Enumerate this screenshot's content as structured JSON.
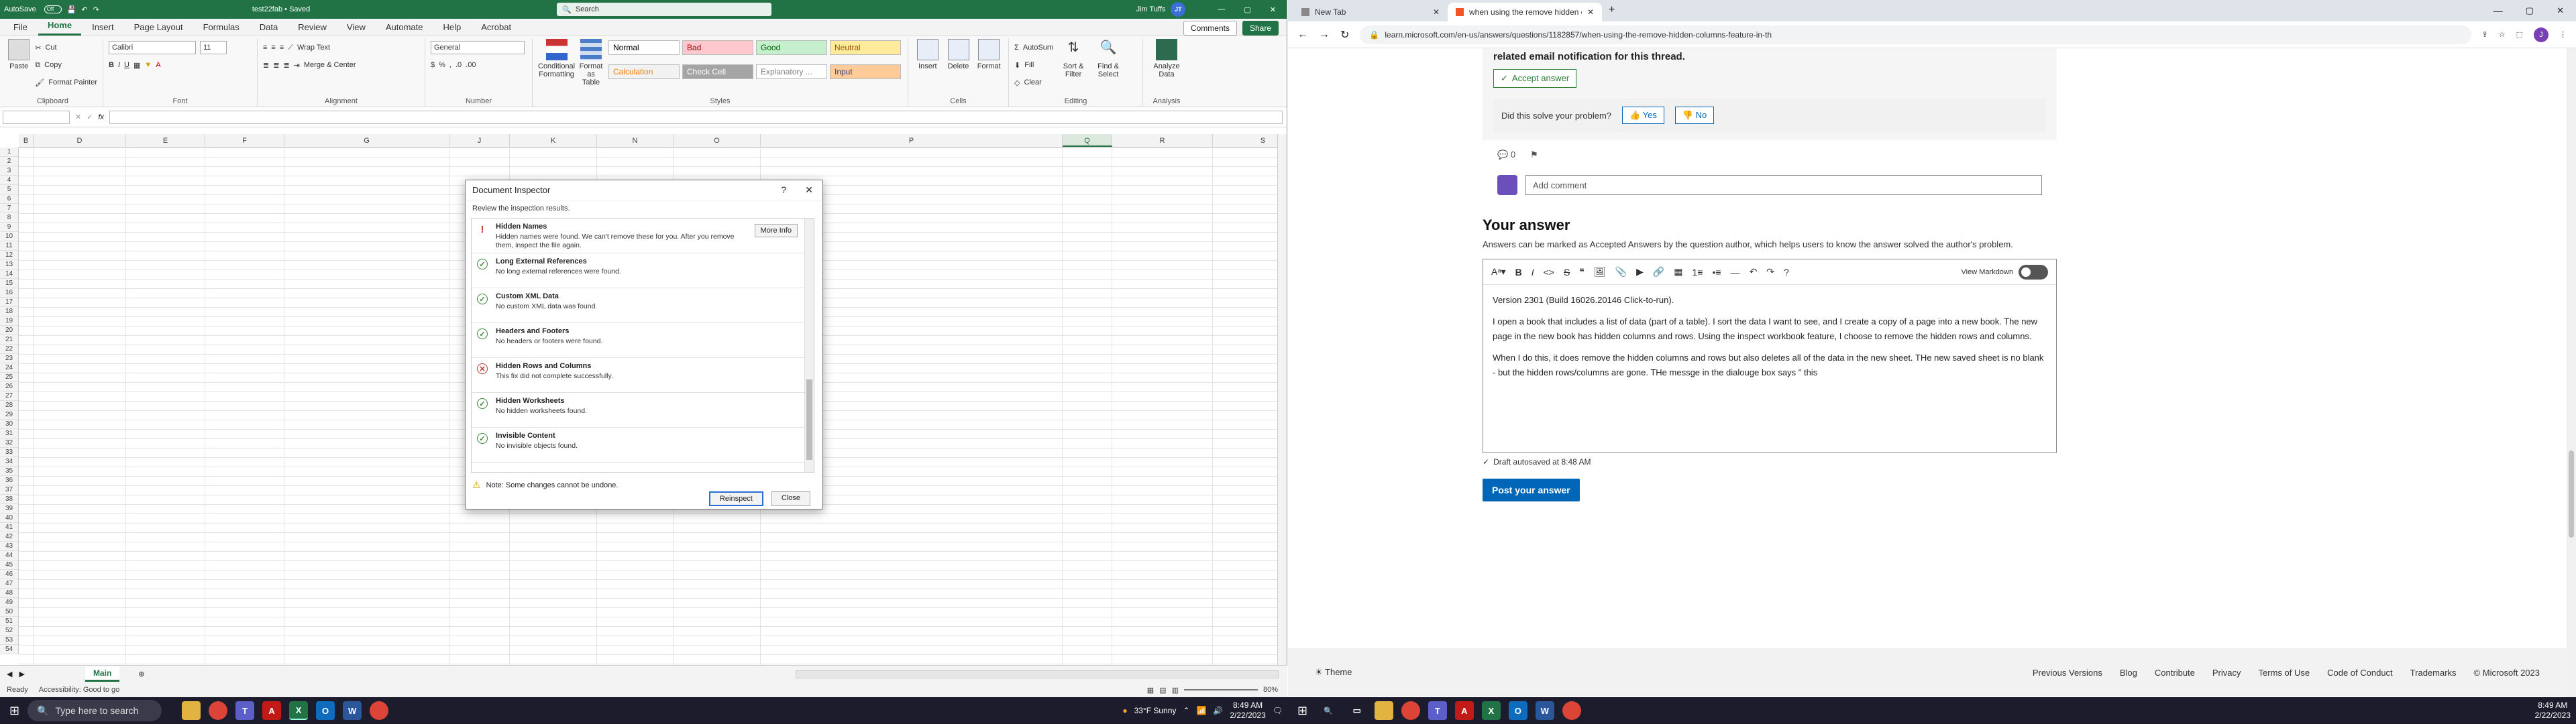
{
  "excel": {
    "title": {
      "autosave_label": "AutoSave",
      "autosave_state": "Off",
      "filename": "test22fab • Saved",
      "search_placeholder": "Search",
      "user_name": "Jim Tuffs",
      "user_initials": "JT"
    },
    "tabs": [
      "File",
      "Home",
      "Insert",
      "Page Layout",
      "Formulas",
      "Data",
      "Review",
      "View",
      "Automate",
      "Help",
      "Acrobat"
    ],
    "comments_btn": "Comments",
    "share_btn": "Share",
    "ribbon": {
      "clipboard": {
        "paste": "Paste",
        "cut": "Cut",
        "copy": "Copy",
        "format_painter": "Format Painter",
        "label": "Clipboard"
      },
      "font": {
        "name": "Calibri",
        "size": "11",
        "label": "Font"
      },
      "alignment": {
        "wrap": "Wrap Text",
        "merge": "Merge & Center",
        "label": "Alignment"
      },
      "number": {
        "format": "General",
        "label": "Number"
      },
      "styles": {
        "cond_format": "Conditional Formatting",
        "format_table": "Format as Table",
        "cells": [
          {
            "name": "Normal",
            "bg": "#ffffff",
            "fg": "#000000"
          },
          {
            "name": "Bad",
            "bg": "#ffc7ce",
            "fg": "#9c0006"
          },
          {
            "name": "Good",
            "bg": "#c6efce",
            "fg": "#006100"
          },
          {
            "name": "Neutral",
            "bg": "#ffeb9c",
            "fg": "#9c5700"
          },
          {
            "name": "Calculation",
            "bg": "#f2f2f2",
            "fg": "#fa7d00"
          },
          {
            "name": "Check Cell",
            "bg": "#a5a5a5",
            "fg": "#ffffff"
          },
          {
            "name": "Explanatory ...",
            "bg": "#ffffff",
            "fg": "#7f7f7f"
          },
          {
            "name": "Input",
            "bg": "#ffcc99",
            "fg": "#3f3f76"
          }
        ],
        "label": "Styles"
      },
      "cells": {
        "insert": "Insert",
        "delete": "Delete",
        "format": "Format",
        "label": "Cells"
      },
      "editing": {
        "autosum": "AutoSum",
        "fill": "Fill",
        "clear": "Clear",
        "sort": "Sort & Filter",
        "find": "Find & Select",
        "label": "Editing"
      },
      "analysis": {
        "analyze": "Analyze Data",
        "label": "Analysis"
      }
    },
    "formula_bar": {
      "fx": "fx"
    },
    "columns": [
      "B",
      "D",
      "E",
      "F",
      "G",
      "J",
      "K",
      "N",
      "O",
      "P",
      "Q",
      "R",
      "S"
    ],
    "selected_column": "Q",
    "rows": [
      "1",
      "2",
      "3",
      "4",
      "5",
      "6",
      "7",
      "8",
      "9",
      "10",
      "11",
      "12",
      "13",
      "14",
      "15",
      "16",
      "17",
      "18",
      "19",
      "20",
      "21",
      "22",
      "23",
      "24",
      "25",
      "26",
      "27",
      "28",
      "29",
      "30",
      "31",
      "32",
      "33",
      "34",
      "35",
      "36",
      "37",
      "38",
      "39",
      "40",
      "41",
      "42",
      "43",
      "44",
      "45",
      "46",
      "47",
      "48",
      "49",
      "50",
      "51",
      "52",
      "53",
      "54"
    ],
    "sheet_tab": "Main",
    "status": {
      "ready": "Ready",
      "accessibility": "Accessibility: Good to go",
      "zoom": "80%"
    }
  },
  "dialog": {
    "title": "Document Inspector",
    "subtitle": "Review the inspection results.",
    "items": [
      {
        "title": "Hidden Names",
        "desc": "Hidden names were found. We can't remove these for you. After you remove them, inspect the file again.",
        "status": "warn",
        "button": "More Info"
      },
      {
        "title": "Long External References",
        "desc": "No long external references were found.",
        "status": "ok"
      },
      {
        "title": "Custom XML Data",
        "desc": "No custom XML data was found.",
        "status": "ok"
      },
      {
        "title": "Headers and Footers",
        "desc": "No headers or footers were found.",
        "status": "ok"
      },
      {
        "title": "Hidden Rows and Columns",
        "desc": "This fix did not complete successfully.",
        "status": "err"
      },
      {
        "title": "Hidden Worksheets",
        "desc": "No hidden worksheets found.",
        "status": "ok"
      },
      {
        "title": "Invisible Content",
        "desc": "No invisible objects found.",
        "status": "ok"
      }
    ],
    "note": "Note: Some changes cannot be undone.",
    "reinspect": "Reinspect",
    "close": "Close",
    "help": "?",
    "x": "✕"
  },
  "browser": {
    "tabs": [
      {
        "label": "New Tab",
        "active": false
      },
      {
        "label": "when using the remove hidden c...",
        "active": true
      }
    ],
    "url": "learn.microsoft.com/en-us/answers/questions/1182857/when-using-the-remove-hidden-columns-feature-in-th",
    "profile": "J",
    "notify_text": "related email notification for this thread.",
    "accept_btn": "Accept answer",
    "solve_q": "Did this solve your problem?",
    "yes": "Yes",
    "no": "No",
    "comment_count": "0",
    "comment_placeholder": "Add comment",
    "your_answer": "Your answer",
    "answer_note": "Answers can be marked as Accepted Answers by the question author, which helps users to know the answer solved the author's problem.",
    "view_markdown": "View Markdown",
    "editor_paragraphs": [
      "Version 2301 (Build 16026.20146 Click-to-run).",
      "I open a book that includes a list of data (part of a table).  I sort the data I want to see, and I create a copy of a page into a new book.    The new page in the new book has hidden columns and rows.  Using the inspect workbook feature, I choose to remove the hidden rows and columns.",
      "When I do this, it does remove the hidden columns and rows but also deletes all of the data in the new sheet.  THe new saved sheet is no blank - but the hidden rows/columns are gone.  THe messge in the dialouge box says \" this"
    ],
    "draft_saved": "Draft autosaved at 8:48 AM",
    "post_btn": "Post your answer",
    "footer": {
      "theme": "Theme",
      "links": [
        "Previous Versions",
        "Blog",
        "Contribute",
        "Privacy",
        "Terms of Use",
        "Code of Conduct",
        "Trademarks",
        "© Microsoft 2023"
      ]
    }
  },
  "taskbar": {
    "search": "Type here to search",
    "weather": "33°F  Sunny",
    "time": "8:49 AM",
    "date": "2/22/2023"
  }
}
